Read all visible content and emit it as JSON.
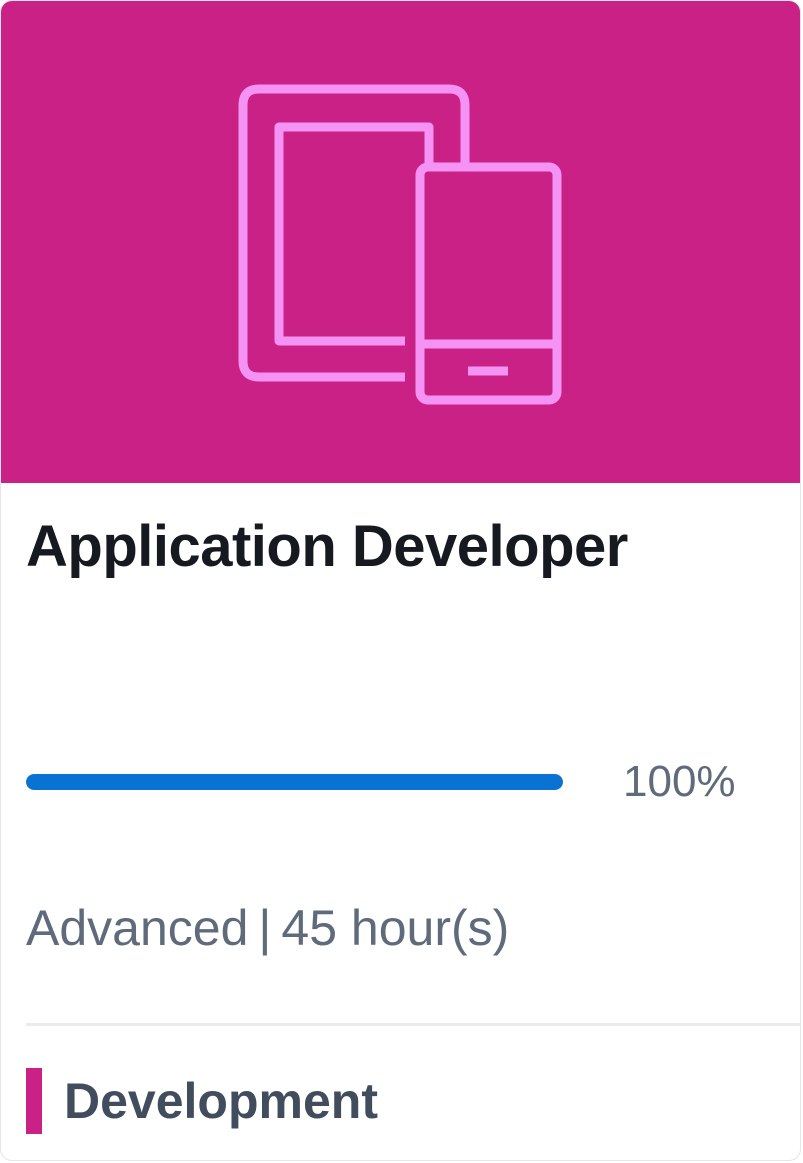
{
  "card": {
    "title": "Application Developer",
    "banner_color": "#c92186",
    "icon": "tablet-and-phone-icon",
    "progress": {
      "percent": 100,
      "label": "100%",
      "color": "#0972d3"
    },
    "meta": {
      "level": "Advanced",
      "separator": "|",
      "duration": "45 hour(s)"
    },
    "category": {
      "label": "Development",
      "color": "#c92186"
    }
  }
}
